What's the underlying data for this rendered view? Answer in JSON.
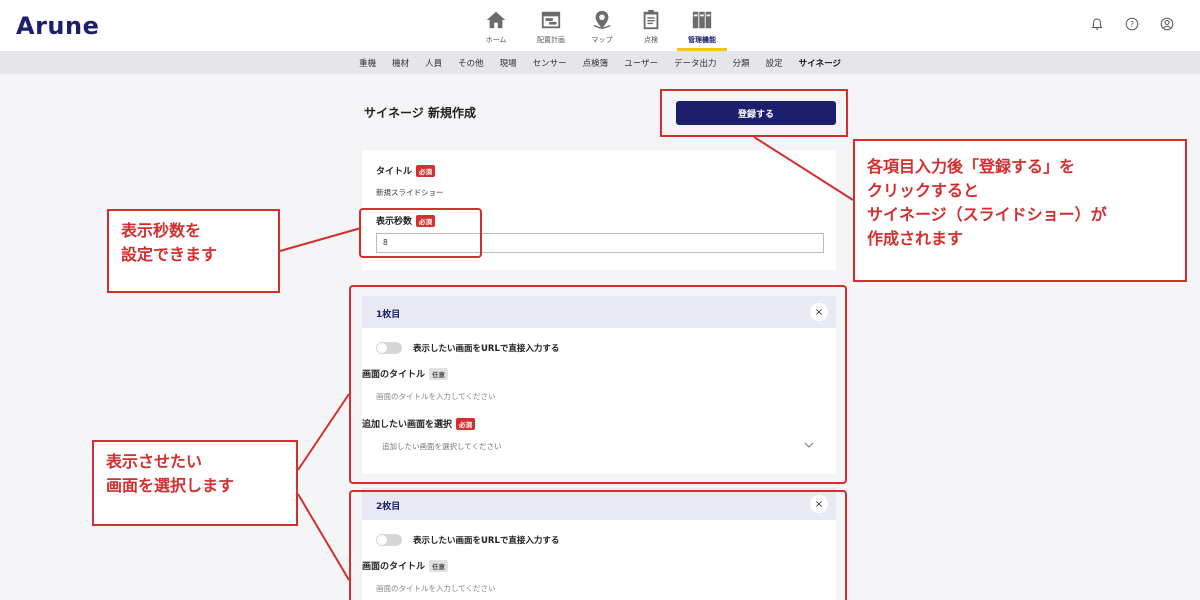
{
  "app": {
    "logo": "Arune"
  },
  "main_nav": [
    {
      "id": "home",
      "label": "ホーム",
      "icon": "home-icon"
    },
    {
      "id": "schedule",
      "label": "配置計画",
      "icon": "calendar-icon"
    },
    {
      "id": "map",
      "label": "マップ",
      "icon": "map-pin-icon"
    },
    {
      "id": "inspection",
      "label": "点検",
      "icon": "clipboard-icon"
    },
    {
      "id": "admin",
      "label": "管理機能",
      "icon": "binders-icon",
      "active": true
    }
  ],
  "header_icons": [
    "bell-icon",
    "help-icon",
    "user-icon"
  ],
  "sub_nav": [
    {
      "label": "重機"
    },
    {
      "label": "機材"
    },
    {
      "label": "人員"
    },
    {
      "label": "その他"
    },
    {
      "label": "現場"
    },
    {
      "label": "センサー"
    },
    {
      "label": "点検簿"
    },
    {
      "label": "ユーザー"
    },
    {
      "label": "データ出力"
    },
    {
      "label": "分類"
    },
    {
      "label": "設定"
    },
    {
      "label": "サイネージ",
      "active": true
    }
  ],
  "page": {
    "title": "サイネージ 新規作成",
    "register_label": "登録する"
  },
  "form": {
    "title_label": "タイトル",
    "required_badge": "必須",
    "optional_badge": "任意",
    "title_value": "新規スライドショー",
    "seconds_label": "表示秒数",
    "seconds_value": "8"
  },
  "slides": [
    {
      "number_label": "1枚目",
      "close": "×",
      "url_toggle_label": "表示したい画面をURLで直接入力する",
      "screen_title_label": "画面のタイトル",
      "screen_title_placeholder": "画面のタイトルを入力してください",
      "select_label": "追加したい画面を選択",
      "select_placeholder": "追加したい画面を選択してください"
    },
    {
      "number_label": "2枚目",
      "close": "×",
      "url_toggle_label": "表示したい画面をURLで直接入力する",
      "screen_title_label": "画面のタイトル",
      "screen_title_placeholder": "画面のタイトルを入力してください"
    }
  ],
  "annotations": {
    "seconds": [
      "表示秒数を",
      "設定できます"
    ],
    "register": [
      "各項目入力後「登録する」を",
      "クリックすると",
      "サイネージ（スライドショー）が",
      "作成されます"
    ],
    "select_screen": [
      "表示させたい",
      "画面を選択します"
    ]
  },
  "colors": {
    "brand": "#1b1f6e",
    "accent": "#f0c419",
    "annotation": "#d32f2f",
    "required": "#d32f2f"
  }
}
